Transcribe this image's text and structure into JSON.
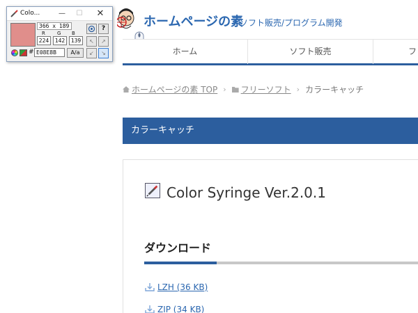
{
  "site": {
    "title": "ホームページの素",
    "tagline": "ソフト販売/プログラム開発"
  },
  "nav": {
    "items": [
      {
        "label": "ホーム"
      },
      {
        "label": "ソフト販売"
      },
      {
        "label": "フ"
      }
    ]
  },
  "breadcrumb": {
    "home": "ホームページの素 TOP",
    "category": "フリーソフト",
    "current": "カラーキャッチ"
  },
  "category_bar": {
    "label": "カラーキャッチ"
  },
  "content": {
    "title": "Color Syringe Ver.2.0.1",
    "download_heading": "ダウンロード",
    "downloads": [
      {
        "label": "LZH (36 KB)"
      },
      {
        "label": "ZIP (34 KB)"
      }
    ]
  },
  "syringe_window": {
    "title": "Colo...",
    "minimize": "—",
    "maximize": "☐",
    "close": "✕",
    "coords": "366 x 189",
    "channels": [
      {
        "label": "R",
        "value": "224"
      },
      {
        "label": "G",
        "value": "142"
      },
      {
        "label": "B",
        "value": "139"
      }
    ],
    "hash": "#",
    "hex": "E08E8B",
    "case_button": "A/a",
    "help_button": "?",
    "swatch_color": "#E08E8B"
  },
  "colors": {
    "brand_blue": "#2c5e9e",
    "link_blue": "#2b67b0"
  }
}
